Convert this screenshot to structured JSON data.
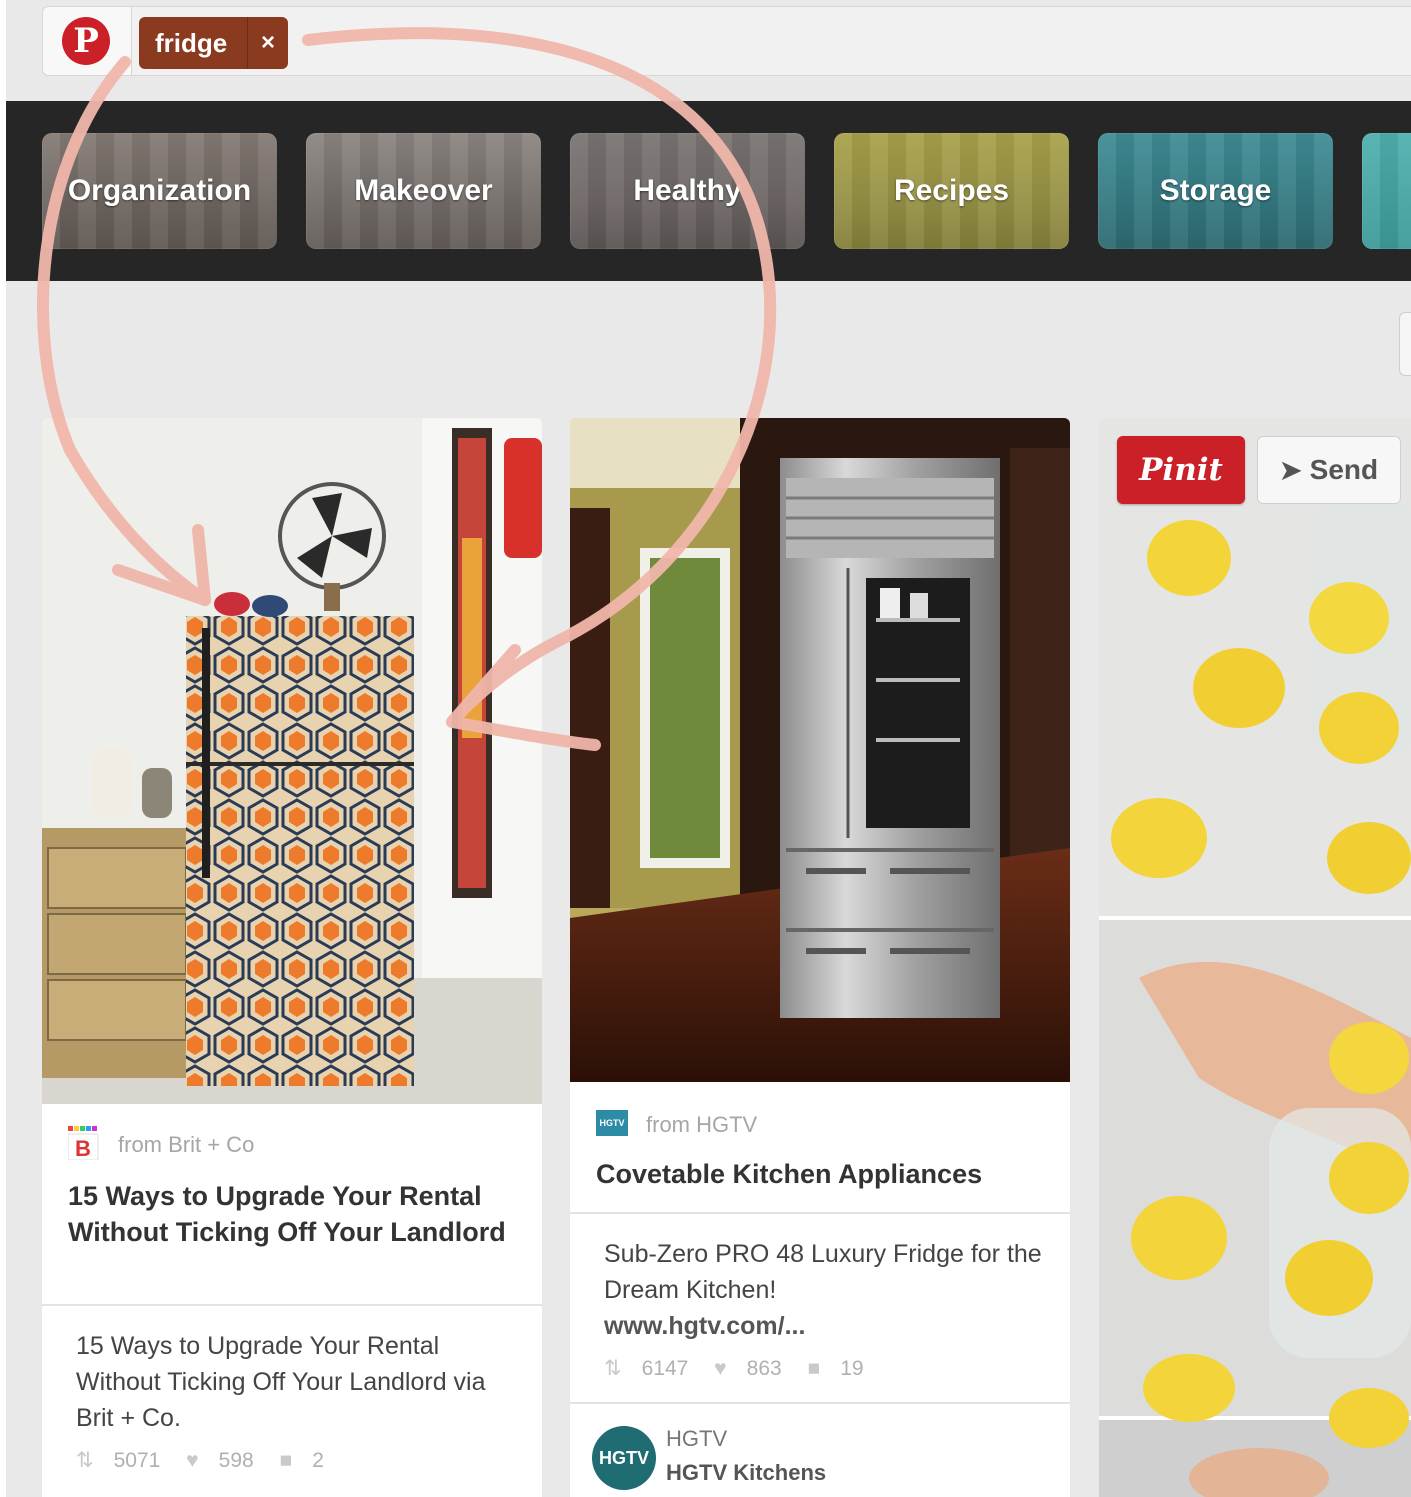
{
  "search": {
    "logo_letter": "P",
    "token_label": "fridge",
    "token_remove": "×"
  },
  "categories": [
    {
      "label": "Organization"
    },
    {
      "label": "Makeover"
    },
    {
      "label": "Healthy"
    },
    {
      "label": "Recipes"
    },
    {
      "label": "Storage"
    },
    {
      "label": ""
    }
  ],
  "pins": [
    {
      "source_icon_letter": "B",
      "source": "from Brit + Co",
      "title": "15 Ways to Upgrade Your Rental Without Ticking Off Your Landlord",
      "description": "15 Ways to Upgrade Your Rental Without Ticking Off Your Landlord via Brit + Co.",
      "repins": "5071",
      "likes": "598",
      "comments": "2"
    },
    {
      "source_icon_letter": "HGTV",
      "source": "from HGTV",
      "title": "Covetable Kitchen Appliances",
      "description": "Sub-Zero PRO 48 Luxury Fridge for the Dream Kitchen!",
      "link": "www.hgtv.com/...",
      "repins": "6147",
      "likes": "863",
      "comments": "19",
      "pinner_avatar": "HGTV",
      "pinner_name": "HGTV",
      "board_name": "HGTV Kitchens"
    },
    {
      "pinit_label": "Pinit",
      "send_label": "Send"
    }
  ],
  "icons": {
    "repin": "repin-icon",
    "like": "heart-icon",
    "comment": "speech-bubble-icon",
    "send": "paper-plane-icon"
  },
  "colors": {
    "pinterest_red": "#cb2027",
    "token_brown": "#8a3a1f",
    "annotation_arrow": "#f0b6aa"
  }
}
